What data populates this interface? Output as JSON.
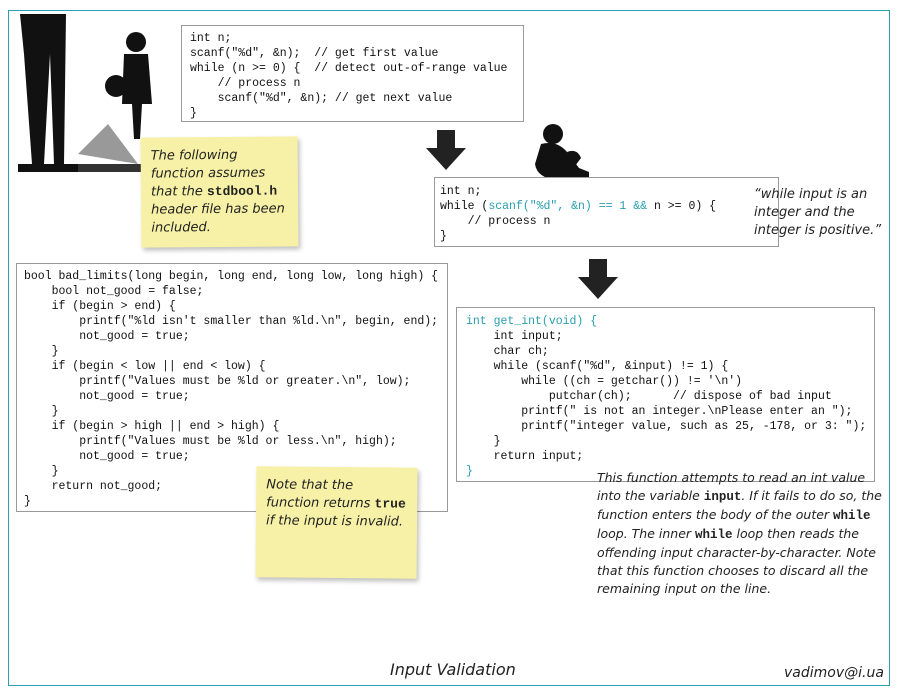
{
  "code1": {
    "lines": [
      "int n;",
      "scanf(\"%d\", &n);  // get first value",
      "while (n >= 0) {  // detect out-of-range value",
      "    // process n",
      "    scanf(\"%d\", &n); // get next value",
      "}"
    ]
  },
  "code2": {
    "line1": "int n;",
    "line2_pre": "while (",
    "line2_hl": "scanf(\"%d\", &n) == 1 &&",
    "line2_post": " n >= 0) {",
    "line3": "    // process n",
    "line4": "}"
  },
  "quote": "“while input is an integer and the integer is positive.”",
  "note1": {
    "pre": "The following function assumes that the ",
    "code": "stdbool.h",
    "post": " header file has been included."
  },
  "code3": {
    "lines": [
      "bool bad_limits(long begin, long end, long low, long high) {",
      "    bool not_good = false;",
      "    if (begin > end) {",
      "        printf(\"%ld isn't smaller than %ld.\\n\", begin, end);",
      "        not_good = true;",
      "    }",
      "    if (begin < low || end < low) {",
      "        printf(\"Values must be %ld or greater.\\n\", low);",
      "        not_good = true;",
      "    }",
      "    if (begin > high || end > high) {",
      "        printf(\"Values must be %ld or less.\\n\", high);",
      "        not_good = true;",
      "    }",
      "    return not_good;",
      "}"
    ]
  },
  "note2": {
    "pre": "Note that the function returns ",
    "code": "true",
    "post": "  if the input is invalid."
  },
  "code4": {
    "first": "int get_int(void) {",
    "body": [
      "    int input;",
      "    char ch;",
      "    while (scanf(\"%d\", &input) != 1) {",
      "        while ((ch = getchar()) != '\\n')",
      "            putchar(ch);      // dispose of bad input",
      "        printf(\" is not an integer.\\nPlease enter an \");",
      "        printf(\"integer value, such as 25, -178, or 3: \");",
      "    }",
      "    return input;"
    ],
    "last": "}"
  },
  "para": {
    "t1": "This function attempts to read an int value into the variable ",
    "c1": "input",
    "t2": ". If it fails to do so, the function enters the body of the outer ",
    "c2": "while",
    "t3": " loop. The inner ",
    "c3": "while",
    "t4": " loop then reads the offending input character-by-character. Note that this function chooses to discard all the remaining input on the line."
  },
  "caption": "Input Validation",
  "email": "vadimov@i.ua",
  "colors": {
    "accent": "#2a9db0",
    "note": "#f6f1a6",
    "arrow": "#222222"
  },
  "icons": [
    "man-and-boy-silhouette",
    "sitting-person-silhouette",
    "down-arrow-icon"
  ]
}
